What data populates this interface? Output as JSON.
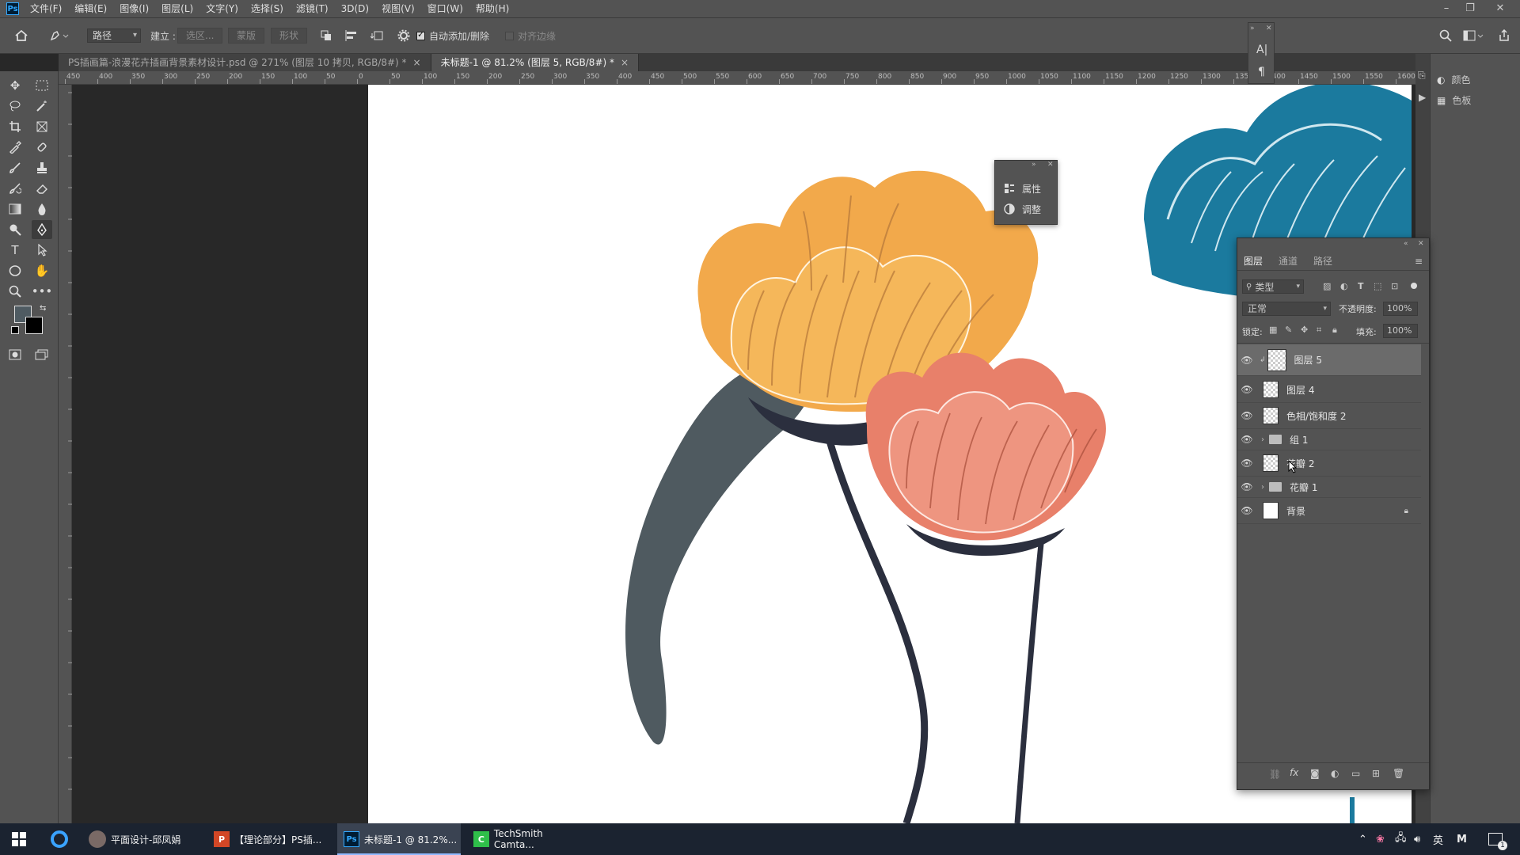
{
  "menubar": {
    "items": [
      "文件(F)",
      "编辑(E)",
      "图像(I)",
      "图层(L)",
      "文字(Y)",
      "选择(S)",
      "滤镜(T)",
      "3D(D)",
      "视图(V)",
      "窗口(W)",
      "帮助(H)"
    ],
    "logo": "Ps"
  },
  "options": {
    "tool_mode": "路径",
    "make_label": "建立 :",
    "selection_btn": "选区...",
    "mask_btn": "蒙版",
    "shape_btn": "形状",
    "auto_add_delete": "自动添加/删除",
    "align_edges": "对齐边缘"
  },
  "tabs": [
    {
      "label": "PS插画篇-浪漫花卉插画背景素材设计.psd @ 271% (图层 10 拷贝, RGB/8#) *",
      "close": "×"
    },
    {
      "label": "未标题-1 @ 81.2% (图层 5, RGB/8#) *",
      "close": "×"
    }
  ],
  "ruler": {
    "ticks": [
      "450",
      "400",
      "350",
      "300",
      "250",
      "200",
      "150",
      "100",
      "50",
      "0",
      "50",
      "100",
      "150",
      "200",
      "250",
      "300",
      "350",
      "400",
      "450",
      "500",
      "550",
      "600",
      "650",
      "700",
      "750",
      "800",
      "850",
      "900",
      "950",
      "1000",
      "1050",
      "1100",
      "1150",
      "1200",
      "1250",
      "1300",
      "1350",
      "1400",
      "1450",
      "1500",
      "1550",
      "1600"
    ]
  },
  "props_panel": {
    "properties": "属性",
    "adjustments": "调整"
  },
  "right_dock": {
    "color": "颜色",
    "swatches": "色板"
  },
  "layers_panel": {
    "tabs": [
      "图层",
      "通道",
      "路径"
    ],
    "filter_kind": "类型",
    "blend_mode": "正常",
    "opacity_label": "不透明度:",
    "opacity_value": "100%",
    "lock_label": "锁定:",
    "fill_label": "填充:",
    "fill_value": "100%",
    "layers": [
      {
        "name": "图层 5",
        "kind": "pixel",
        "selected": true
      },
      {
        "name": "图层 4",
        "kind": "pixel",
        "selected": false
      },
      {
        "name": "色相/饱和度 2",
        "kind": "adjustment",
        "selected": false
      },
      {
        "name": "组 1",
        "kind": "group",
        "selected": false
      },
      {
        "name": "花瓣 2",
        "kind": "pixel",
        "selected": false
      },
      {
        "name": "花瓣 1",
        "kind": "group",
        "selected": false
      },
      {
        "name": "背景",
        "kind": "background",
        "selected": false
      }
    ]
  },
  "taskbar": {
    "items": [
      {
        "label": "平面设计-邱凤娟"
      },
      {
        "label": "【理论部分】PS插..."
      },
      {
        "label": "未标题-1 @ 81.2%..."
      },
      {
        "label": "TechSmith Camta..."
      }
    ],
    "tray": {
      "lang": "英",
      "ime": "M",
      "notif_count": "1"
    }
  }
}
